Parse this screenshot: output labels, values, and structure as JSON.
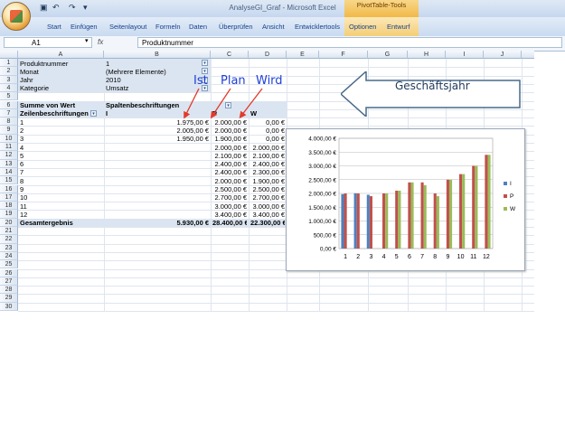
{
  "app": {
    "window_title": "AnalyseGI_Graf - Microsoft Excel",
    "context_tab_group": "PivotTable-Tools"
  },
  "ribbon": {
    "tabs": [
      "Start",
      "Einfügen",
      "Seitenlayout",
      "Formeln",
      "Daten",
      "Überprüfen",
      "Ansicht",
      "Entwicklertools"
    ],
    "pivot_tabs": [
      "Optionen",
      "Entwurf"
    ]
  },
  "formula_bar": {
    "cell_ref": "A1",
    "fx": "fx",
    "content": "Produktnummer"
  },
  "columns": [
    "A",
    "B",
    "C",
    "D",
    "E",
    "F",
    "G",
    "H",
    "I",
    "J",
    "K"
  ],
  "rows": [
    "1",
    "2",
    "3",
    "4",
    "5",
    "6",
    "7",
    "8",
    "9",
    "10",
    "11",
    "12",
    "13",
    "14",
    "15",
    "16",
    "17",
    "18",
    "19",
    "20",
    "21",
    "22",
    "23",
    "24",
    "25",
    "26",
    "27",
    "28",
    "29",
    "30"
  ],
  "pivot": {
    "filters": [
      {
        "label": "Produktnummer",
        "value": "1"
      },
      {
        "label": "Monat",
        "value": "(Mehrere Elemente)"
      },
      {
        "label": "Jahr",
        "value": "2010"
      },
      {
        "label": "Kategorie",
        "value": "Umsatz"
      }
    ],
    "values_label": "Summe von Wert",
    "col_labels_header": "Spaltenbeschriftungen",
    "row_labels_header": "Zeilenbeschriftungen",
    "col_keys": [
      "I",
      "P",
      "W"
    ],
    "rows": [
      {
        "label": "1",
        "I": "1.975,00 €",
        "P": "2.000,00 €",
        "W": "0,00 €"
      },
      {
        "label": "2",
        "I": "2.005,00 €",
        "P": "2.000,00 €",
        "W": "0,00 €"
      },
      {
        "label": "3",
        "I": "1.950,00 €",
        "P": "1.900,00 €",
        "W": "0,00 €"
      },
      {
        "label": "4",
        "I": "",
        "P": "2.000,00 €",
        "W": "2.000,00 €"
      },
      {
        "label": "5",
        "I": "",
        "P": "2.100,00 €",
        "W": "2.100,00 €"
      },
      {
        "label": "6",
        "I": "",
        "P": "2.400,00 €",
        "W": "2.400,00 €"
      },
      {
        "label": "7",
        "I": "",
        "P": "2.400,00 €",
        "W": "2.300,00 €"
      },
      {
        "label": "8",
        "I": "",
        "P": "2.000,00 €",
        "W": "1.900,00 €"
      },
      {
        "label": "9",
        "I": "",
        "P": "2.500,00 €",
        "W": "2.500,00 €"
      },
      {
        "label": "10",
        "I": "",
        "P": "2.700,00 €",
        "W": "2.700,00 €"
      },
      {
        "label": "11",
        "I": "",
        "P": "3.000,00 €",
        "W": "3.000,00 €"
      },
      {
        "label": "12",
        "I": "",
        "P": "3.400,00 €",
        "W": "3.400,00 €"
      }
    ],
    "total": {
      "label": "Gesamtergebnis",
      "I": "5.930,00 €",
      "P": "28.400,00 €",
      "W": "22.300,00 €"
    }
  },
  "annotations": {
    "ist": "Ist",
    "plan": "Plan",
    "wird": "Wird",
    "fiscal_year": "Geschäftsjahr",
    "arrow_color": "#e23a2a",
    "label_color": "#1f3fd6"
  },
  "chart_data": {
    "type": "bar",
    "categories": [
      "1",
      "2",
      "3",
      "4",
      "5",
      "6",
      "7",
      "8",
      "9",
      "10",
      "11",
      "12"
    ],
    "series": [
      {
        "name": "I",
        "color": "#4f81bd",
        "values": [
          1975,
          2005,
          1950,
          0,
          0,
          0,
          0,
          0,
          0,
          0,
          0,
          0
        ]
      },
      {
        "name": "P",
        "color": "#c0504d",
        "values": [
          2000,
          2000,
          1900,
          2000,
          2100,
          2400,
          2400,
          2000,
          2500,
          2700,
          3000,
          3400
        ]
      },
      {
        "name": "W",
        "color": "#9bbb59",
        "values": [
          0,
          0,
          0,
          2000,
          2100,
          2400,
          2300,
          1900,
          2500,
          2700,
          3000,
          3400
        ]
      }
    ],
    "ylim": [
      0,
      4000
    ],
    "yticks": [
      "0,00 €",
      "500,00 €",
      "1.000,00 €",
      "1.500,00 €",
      "2.000,00 €",
      "2.500,00 €",
      "3.000,00 €",
      "3.500,00 €",
      "4.000,00 €"
    ],
    "grid": true,
    "legend": "right"
  }
}
